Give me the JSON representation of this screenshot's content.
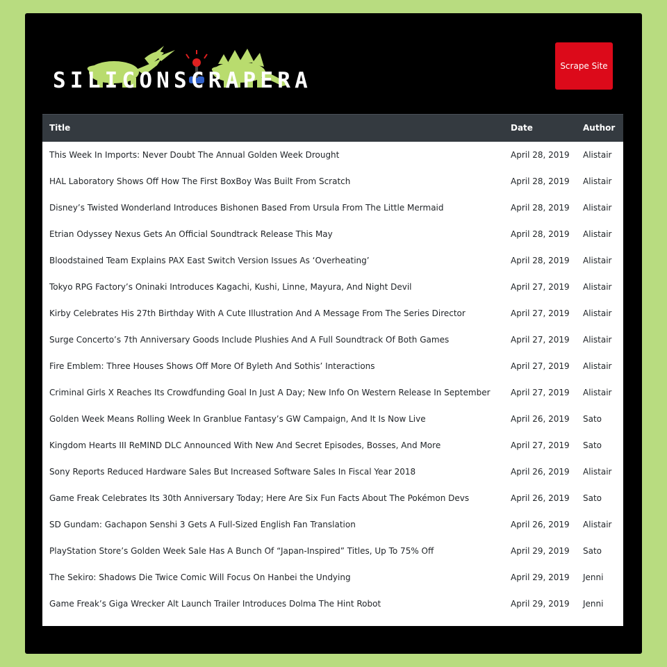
{
  "header": {
    "logo_text": "SILICONSCRAPERA",
    "scrape_button_label": "Scrape Site"
  },
  "colors": {
    "page_background": "#b8dc80",
    "frame_background": "#000000",
    "button_red": "#dc0a1a",
    "table_header": "#343a40",
    "dino_green": "#b9dc6e"
  },
  "table": {
    "columns": [
      "Title",
      "Date",
      "Author"
    ],
    "rows": [
      [
        "This Week In Imports: Never Doubt The Annual Golden Week Drought",
        "April 28, 2019",
        "Alistair"
      ],
      [
        "HAL Laboratory Shows Off How The First BoxBoy Was Built From Scratch",
        "April 28, 2019",
        "Alistair"
      ],
      [
        "Disney’s Twisted Wonderland Introduces Bishonen Based From Ursula From The Little Mermaid",
        "April 28, 2019",
        "Alistair"
      ],
      [
        "Etrian Odyssey Nexus Gets An Official Soundtrack Release This May",
        "April 28, 2019",
        "Alistair"
      ],
      [
        "Bloodstained Team Explains PAX East Switch Version Issues As ‘Overheating’",
        "April 28, 2019",
        "Alistair"
      ],
      [
        "Tokyo RPG Factory’s Oninaki Introduces Kagachi, Kushi, Linne, Mayura, And Night Devil",
        "April 27, 2019",
        "Alistair"
      ],
      [
        "Kirby Celebrates His 27th Birthday With A Cute Illustration And A Message From The Series Director",
        "April 27, 2019",
        "Alistair"
      ],
      [
        "Surge Concerto’s 7th Anniversary Goods Include Plushies And A Full Soundtrack Of Both Games",
        "April 27, 2019",
        "Alistair"
      ],
      [
        "Fire Emblem: Three Houses Shows Off More Of Byleth And Sothis’ Interactions",
        "April 27, 2019",
        "Alistair"
      ],
      [
        "Criminal Girls X Reaches Its Crowdfunding Goal In Just A Day; New Info On Western Release In September",
        "April 27, 2019",
        "Alistair"
      ],
      [
        "Golden Week Means Rolling Week In Granblue Fantasy’s GW Campaign, And It Is Now Live",
        "April 26, 2019",
        "Sato"
      ],
      [
        "Kingdom Hearts III ReMIND DLC Announced With New And Secret Episodes, Bosses, And More",
        "April 27, 2019",
        "Sato"
      ],
      [
        "Sony Reports Reduced Hardware Sales But Increased Software Sales In Fiscal Year 2018",
        "April 26, 2019",
        "Alistair"
      ],
      [
        "Game Freak Celebrates Its 30th Anniversary Today; Here Are Six Fun Facts About The Pokémon Devs",
        "April 26, 2019",
        "Sato"
      ],
      [
        "SD Gundam: Gachapon Senshi 3 Gets A Full-Sized English Fan Translation",
        "April 26, 2019",
        "Alistair"
      ],
      [
        "PlayStation Store’s Golden Week Sale Has A Bunch Of “Japan-Inspired” Titles, Up To 75% Off",
        "April 29, 2019",
        "Sato"
      ],
      [
        "The Sekiro: Shadows Die Twice Comic Will Focus On Hanbei the Undying",
        "April 29, 2019",
        "Jenni"
      ],
      [
        "Game Freak’s Giga Wrecker Alt Launch Trailer Introduces Dolma The Hint Robot",
        "April 29, 2019",
        "Jenni"
      ]
    ]
  }
}
